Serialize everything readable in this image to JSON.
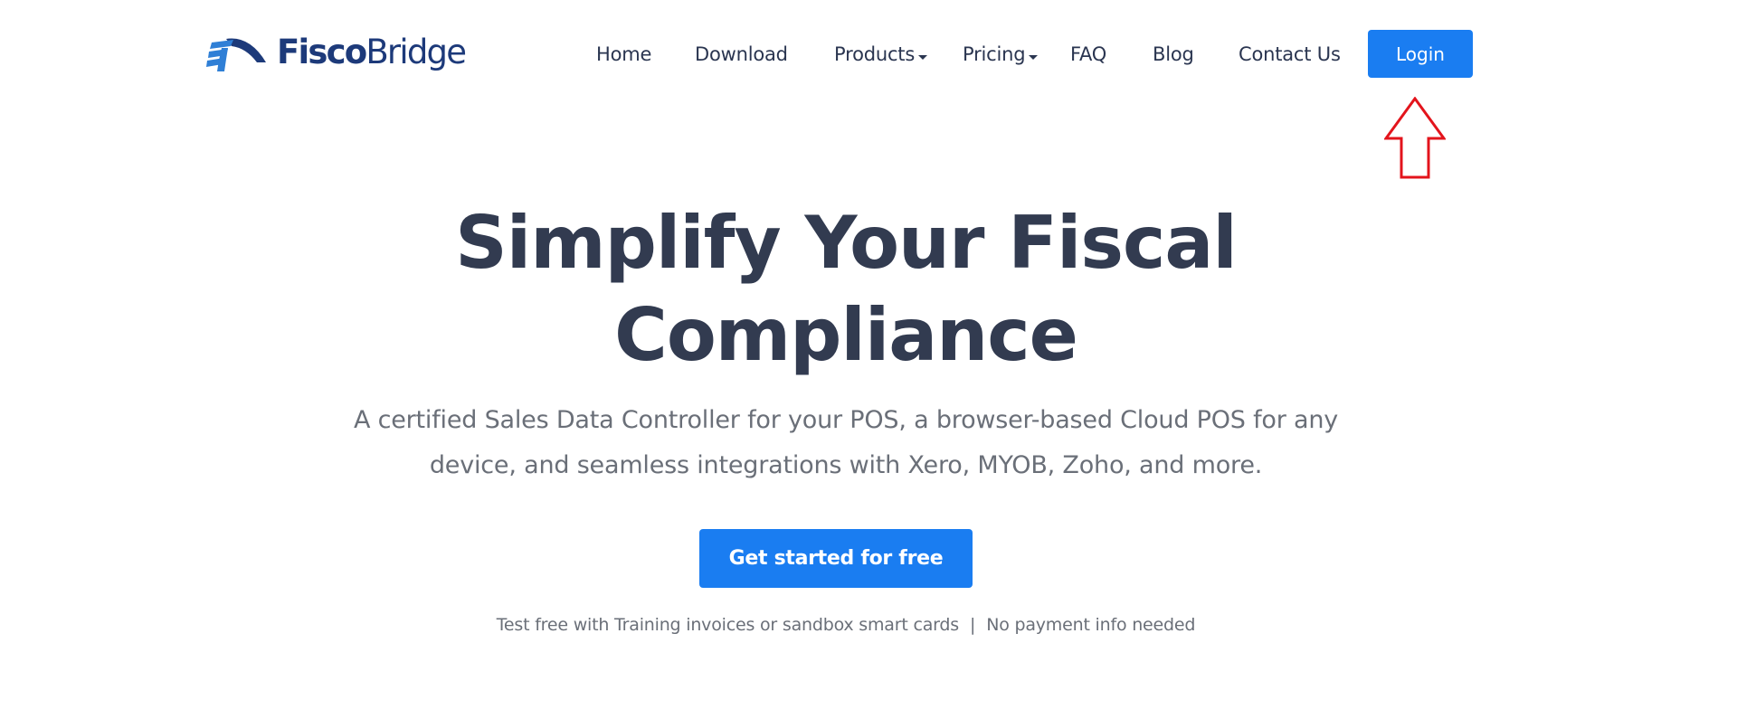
{
  "header": {
    "logo": {
      "text_bold": "Fisco",
      "text_light": "Bridge",
      "icon": "bridge-logo-icon",
      "colors": {
        "arc": "#1d3a7a",
        "stripes": "#2f7fd6"
      }
    },
    "nav": {
      "items": [
        {
          "label": "Home",
          "has_dropdown": false
        },
        {
          "label": "Download",
          "has_dropdown": false
        },
        {
          "label": "Products",
          "has_dropdown": true
        },
        {
          "label": "Pricing",
          "has_dropdown": true
        },
        {
          "label": "FAQ",
          "has_dropdown": false
        },
        {
          "label": "Blog",
          "has_dropdown": false
        },
        {
          "label": "Contact Us",
          "has_dropdown": false
        }
      ],
      "login_label": "Login"
    },
    "annotation": {
      "icon": "up-arrow-annotation-icon",
      "color": "#e3141c"
    }
  },
  "hero": {
    "title_line1": "Simplify Your Fiscal",
    "title_line2": "Compliance",
    "subtitle_line1": "A certified Sales Data Controller for your POS, a browser-based Cloud POS for any",
    "subtitle_line2": "device, and seamless integrations with Xero, MYOB, Zoho, and more.",
    "cta_label": "Get started for free",
    "note_left": "Test free with Training invoices or sandbox smart cards",
    "note_separator": "|",
    "note_right": "No payment info needed"
  },
  "colors": {
    "accent": "#1a7df1",
    "heading": "#323b50",
    "nav_text": "#2a3550",
    "body_text": "#6a6f78",
    "background": "#ffffff"
  }
}
